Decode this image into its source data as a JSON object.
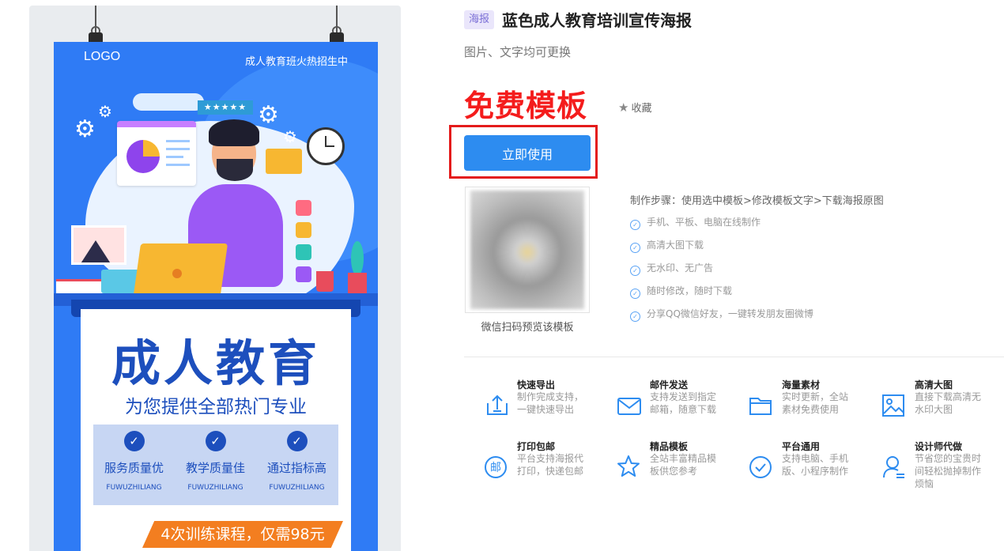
{
  "poster": {
    "logo": "LOGO",
    "slogan": "成人教育班火热招生中",
    "stars": "★★★★★",
    "headline": "成人教育",
    "subheadline": "为您提供全部热门专业",
    "features": [
      {
        "title": "服务质量优",
        "en": "FUWUZHILIANG"
      },
      {
        "title": "教学质量佳",
        "en": "FUWUZHILIANG"
      },
      {
        "title": "通过指标高",
        "en": "FUWUZHILIANG"
      }
    ],
    "course": "4次训练课程，仅需98元"
  },
  "header": {
    "tag": "海报",
    "title": "蓝色成人教育培训宣传海报",
    "subtitle": "图片、文字均可更换"
  },
  "price_label": "免费模板",
  "favorite_label": "收藏",
  "use_button_label": "立即使用",
  "qr_caption": "微信扫码预览该模板",
  "steps_text": "制作步骤：使用选中模板>修改模板文字>下载海报原图",
  "checks": [
    "手机、平板、电脑在线制作",
    "高清大图下载",
    "无水印、无广告",
    "随时修改，随时下载",
    "分享QQ微信好友，一键转发朋友圈微博"
  ],
  "services": [
    {
      "title": "快速导出",
      "desc": "制作完成支持，一键快速导出",
      "icon": "export-icon"
    },
    {
      "title": "邮件发送",
      "desc": "支持发送到指定邮箱，随意下载",
      "icon": "mail-icon"
    },
    {
      "title": "海量素材",
      "desc": "实时更新，全站素材免费使用",
      "icon": "folder-icon"
    },
    {
      "title": "高清大图",
      "desc": "直接下载高清无水印大图",
      "icon": "image-icon"
    },
    {
      "title": "打印包邮",
      "desc": "平台支持海报代打印，快递包邮",
      "icon": "post-icon",
      "glyph": "邮"
    },
    {
      "title": "精品模板",
      "desc": "全站丰富精品模板供您参考",
      "icon": "star-icon"
    },
    {
      "title": "平台通用",
      "desc": "支持电脑、手机版、小程序制作",
      "icon": "check-circle-icon"
    },
    {
      "title": "设计师代做",
      "desc": "节省您的宝贵时间轻松抛掉制作烦恼",
      "icon": "designer-icon"
    }
  ],
  "colors": {
    "accent": "#2d8cf0",
    "price": "#f41c1c",
    "poster_blue": "#2f7bf5",
    "highlight_frame": "#e41b1b"
  }
}
